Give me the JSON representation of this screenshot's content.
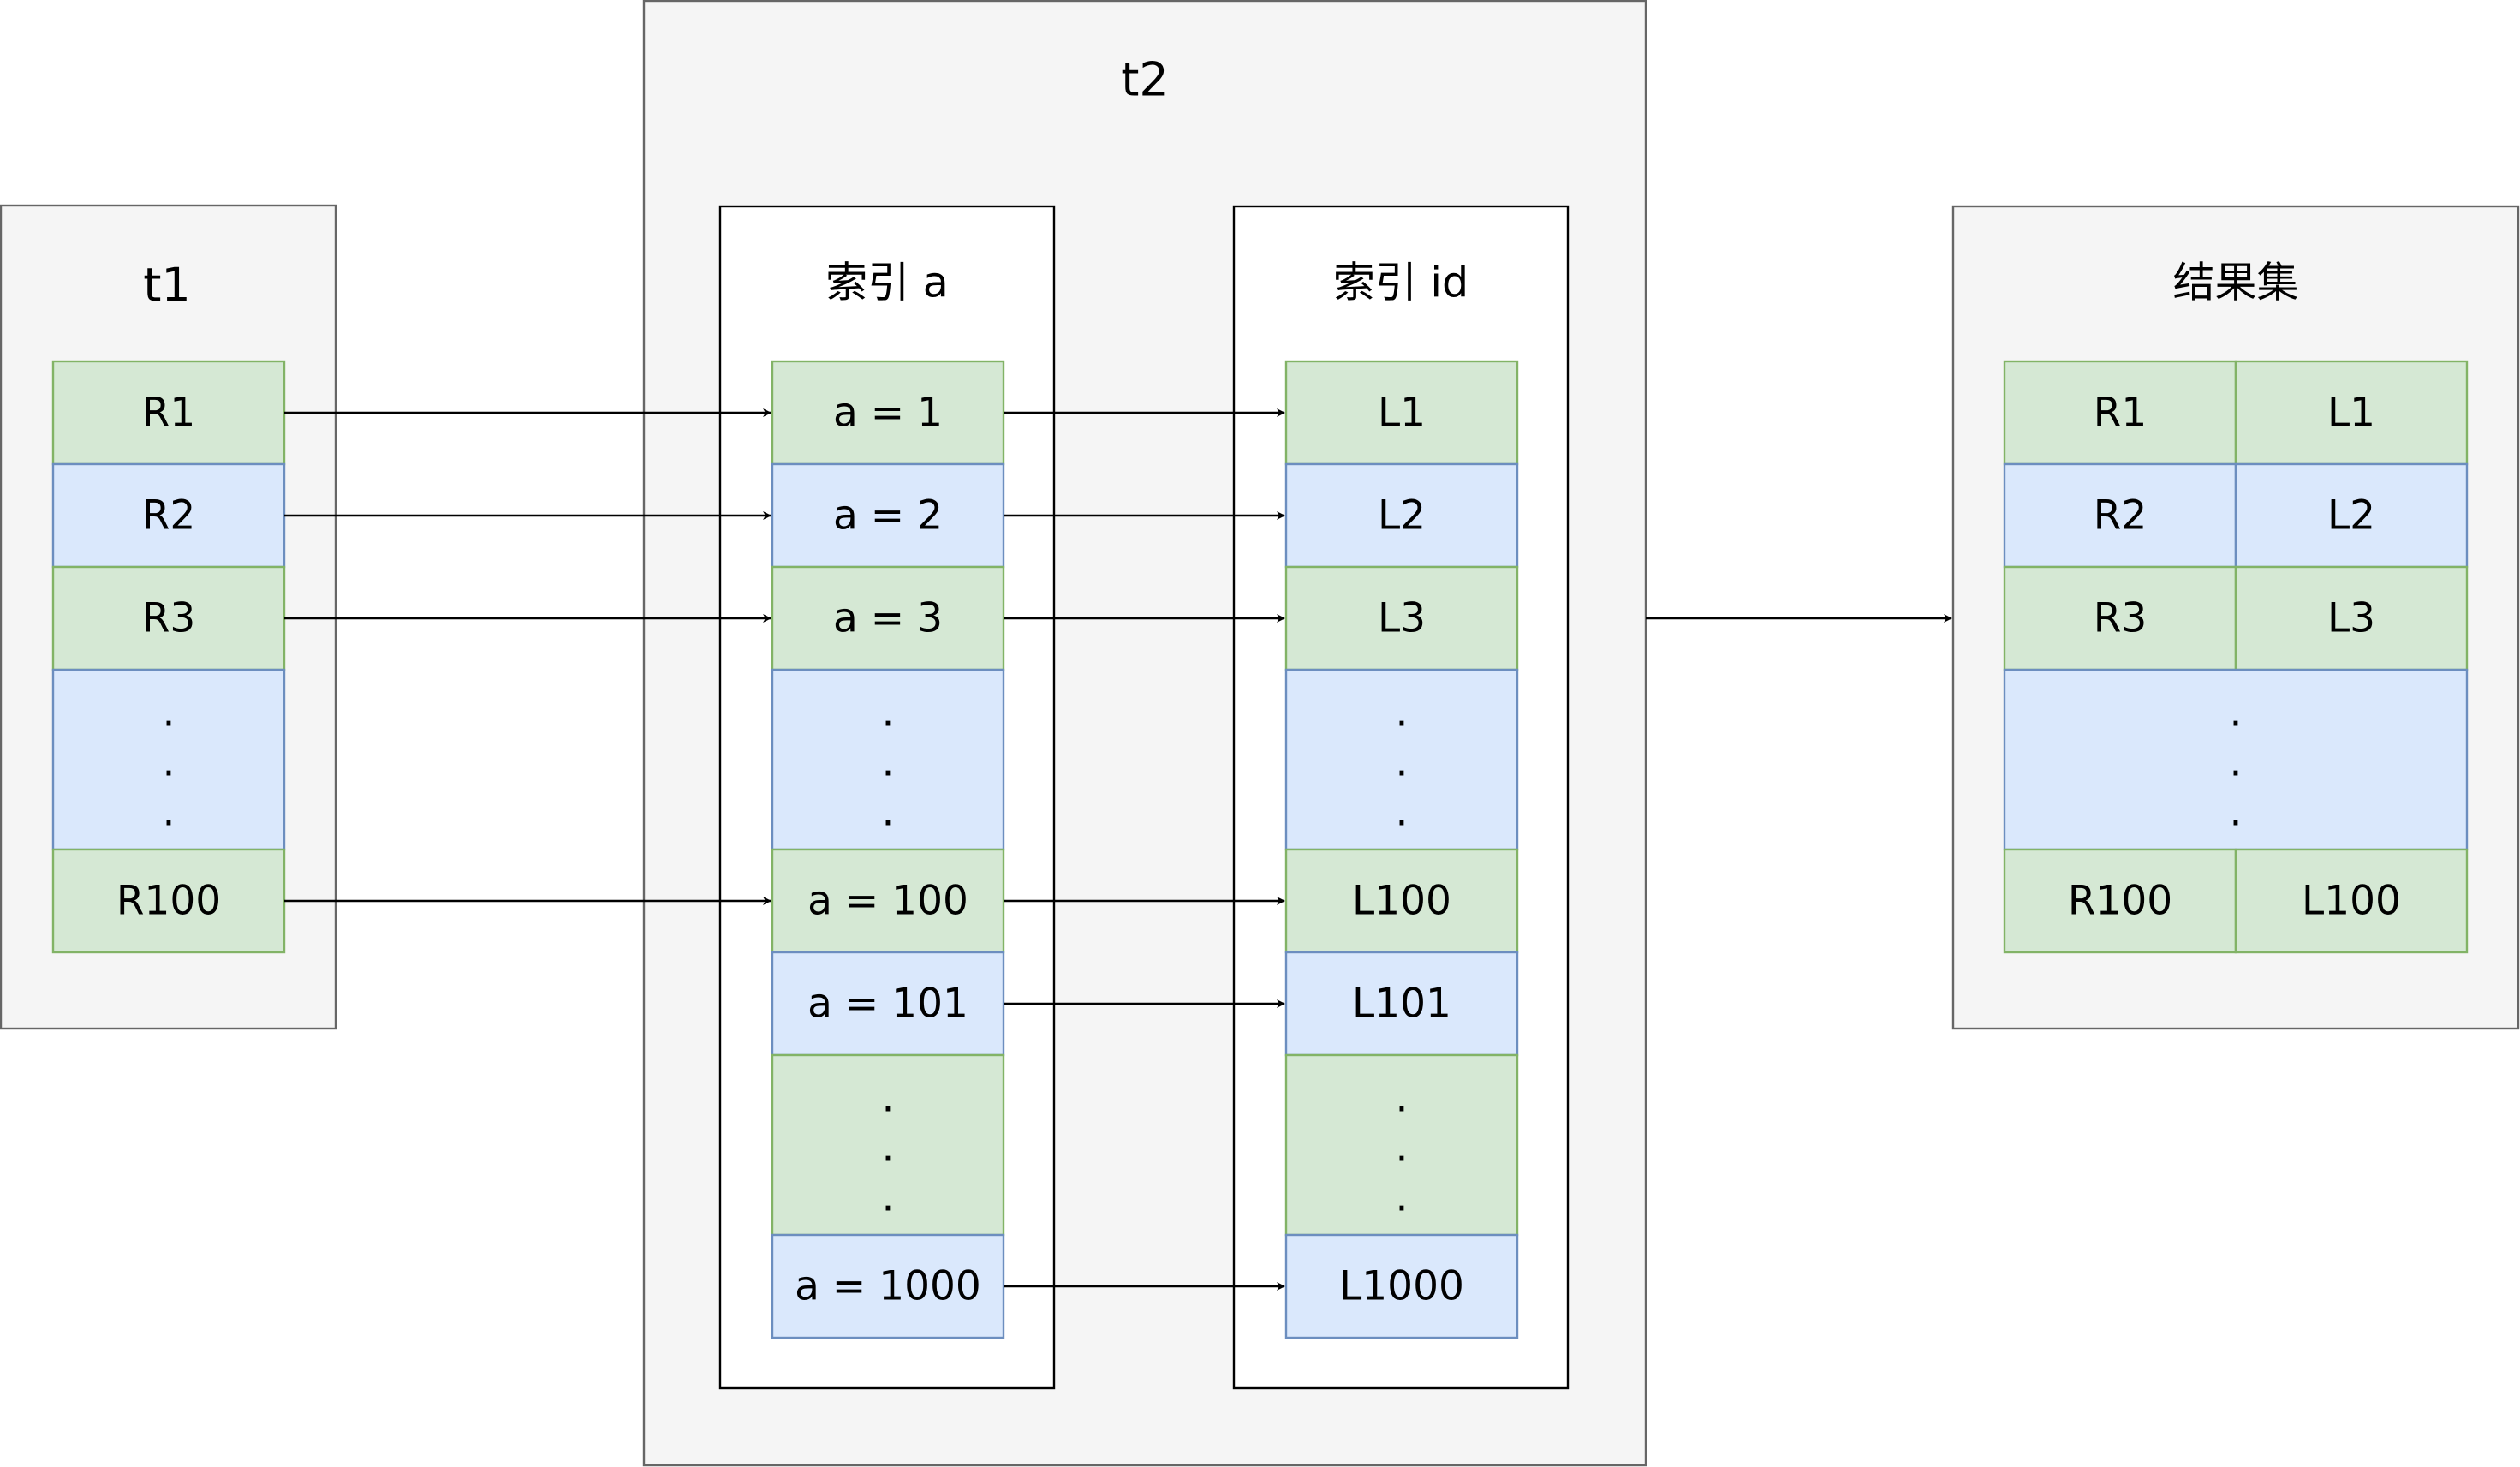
{
  "t1": {
    "title": "t1",
    "rows": [
      "R1",
      "R2",
      "R3",
      ". . .",
      "R100"
    ]
  },
  "t2": {
    "title": "t2",
    "index_a": {
      "title": "索引 a",
      "rows": [
        "a = 1",
        "a = 2",
        "a = 3",
        ". . .",
        "a = 100",
        "a = 101",
        ". . .",
        "a = 1000"
      ]
    },
    "index_id": {
      "title": "索引 id",
      "rows": [
        "L1",
        "L2",
        "L3",
        ". . .",
        "L100",
        "L101",
        ". . .",
        "L1000"
      ]
    }
  },
  "result": {
    "title": "结果集",
    "rows": [
      [
        "R1",
        "L1"
      ],
      [
        "R2",
        "L2"
      ],
      [
        "R3",
        "L3"
      ],
      [
        ". . ."
      ],
      [
        "R100",
        "L100"
      ]
    ]
  },
  "colors": {
    "green_fill": "#d5e8d4",
    "green_stroke": "#82b366",
    "blue_fill": "#dae8fc",
    "blue_stroke": "#6c8ebf",
    "panel_fill": "#f5f5f5"
  }
}
